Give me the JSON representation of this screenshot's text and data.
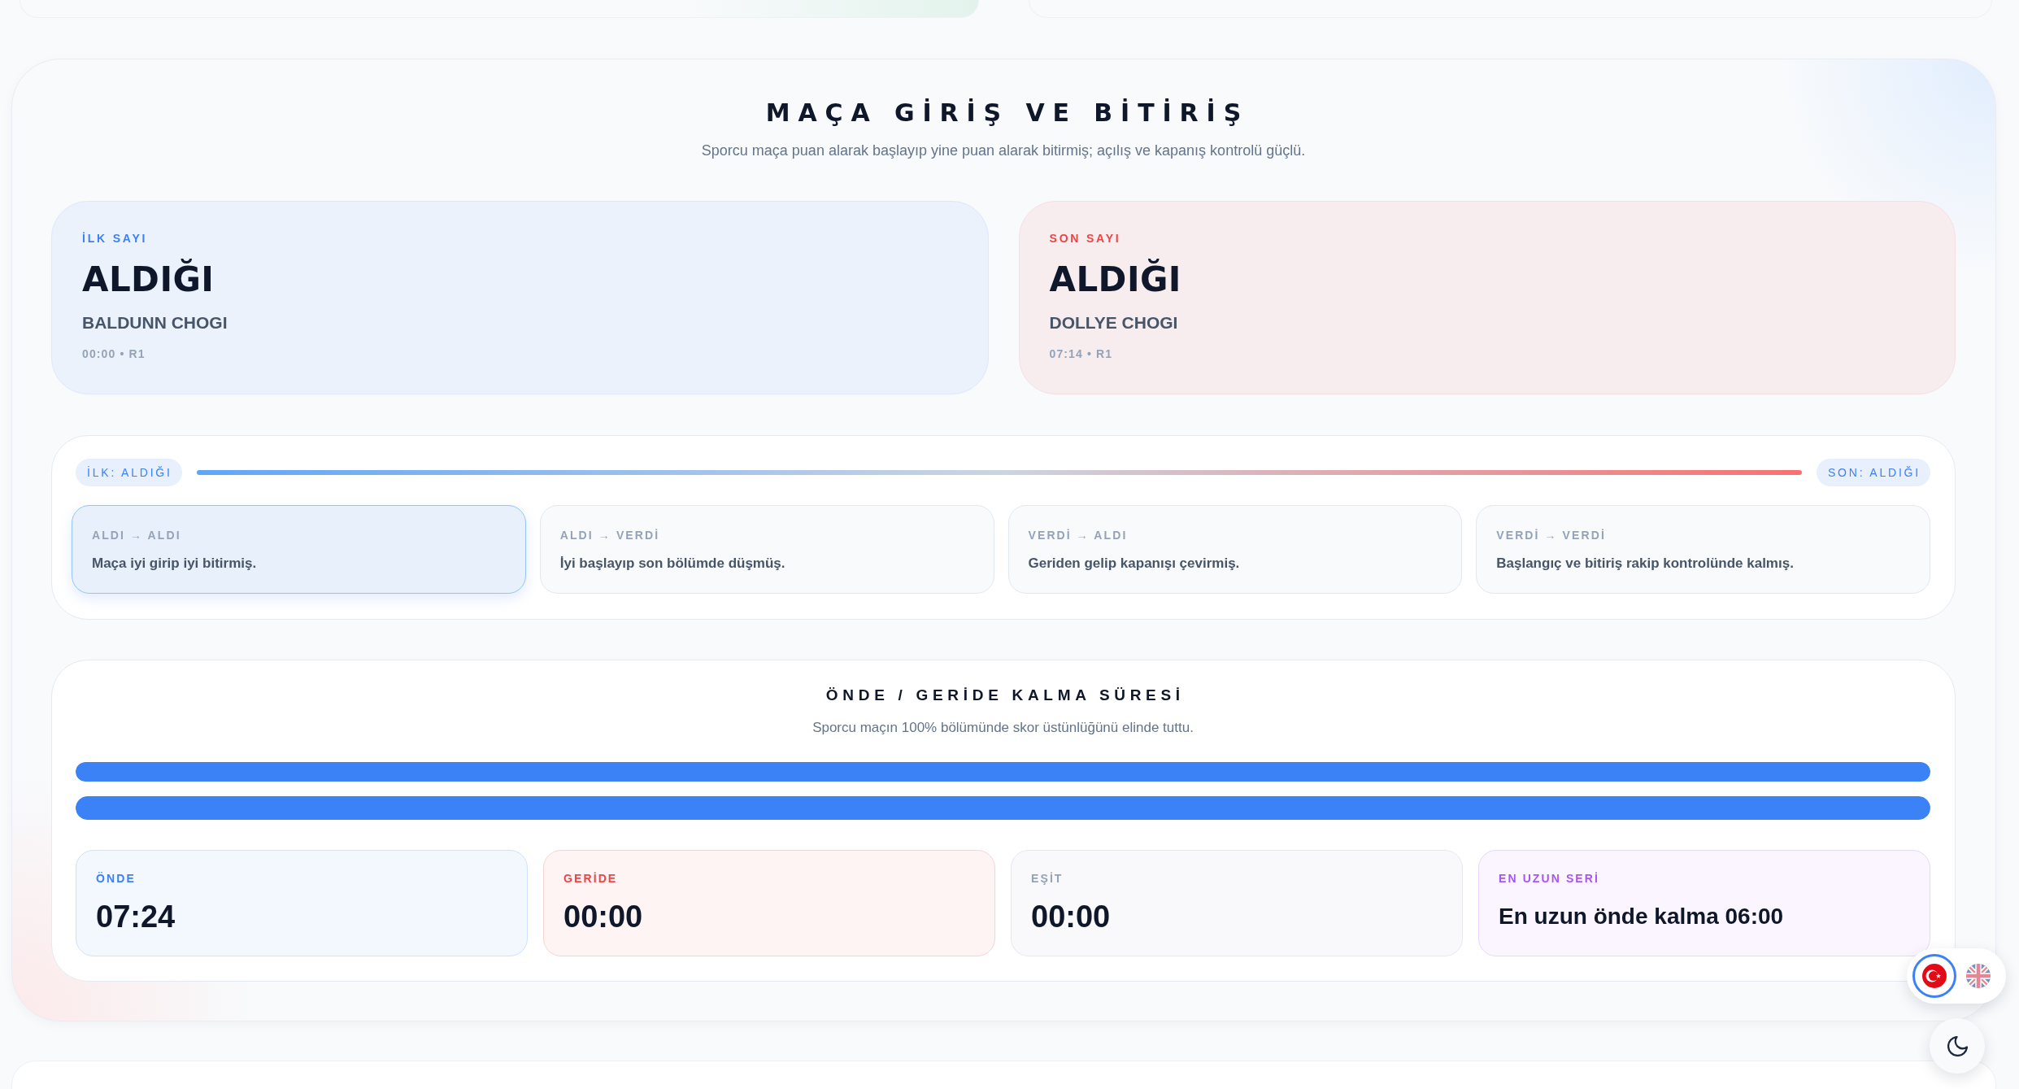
{
  "section": {
    "title": "MAÇA GİRİŞ VE BİTİRİŞ",
    "subtitle": "Sporcu maça puan alarak başlayıp yine puan alarak bitirmiş; açılış ve kapanış kontrolü güçlü.",
    "point_cards": [
      {
        "label": "İLK SAYI",
        "result": "ALDIĞI",
        "player": "BALDUNN CHOGI",
        "meta": "00:00 • R1",
        "color": "#3b82f6"
      },
      {
        "label": "SON SAYI",
        "result": "ALDIĞI",
        "player": "DOLLYE CHOGI",
        "meta": "07:14 • R1",
        "color": "#ef4444"
      }
    ],
    "flow": {
      "start_badge": "İLK: ALDIĞI",
      "end_badge": "SON: ALDIĞI",
      "scenarios": [
        {
          "label": "ALDI → ALDI",
          "text": "Maça iyi girip iyi bitirmiş.",
          "selected": true
        },
        {
          "label": "ALDI → VERDİ",
          "text": "İyi başlayıp son bölümde düşmüş.",
          "selected": false
        },
        {
          "label": "VERDİ → ALDI",
          "text": "Geriden gelip kapanışı çevirmiş.",
          "selected": false
        },
        {
          "label": "VERDİ → VERDİ",
          "text": "Başlangıç ve bitiriş rakip kontrolünde kalmış.",
          "selected": false
        }
      ]
    },
    "lead_time": {
      "title": "ÖNDE / GERİDE KALMA SÜRESİ",
      "subtitle": "Sporcu maçın 100% bölümünde skor üstünlüğünü elinde tuttu.",
      "bars": [
        {
          "level": 1
        },
        {
          "level": 1
        }
      ],
      "stats": [
        {
          "kind": "duration",
          "label": "ÖNDE",
          "value": "07:24",
          "color": "#3b82f6"
        },
        {
          "kind": "duration",
          "label": "GERİDE",
          "value": "00:00",
          "color": "#ef4444"
        },
        {
          "kind": "duration",
          "label": "EŞİT",
          "value": "00:00",
          "color": "#94a3b8"
        },
        {
          "kind": "summary",
          "label": "EN UZUN SERİ",
          "value": "En uzun önde kalma 06:00",
          "color": "#a855f7"
        }
      ]
    }
  },
  "language_switcher": {
    "options": [
      {
        "kind": "tr",
        "selected": true
      },
      {
        "kind": "gb",
        "selected": false
      }
    ]
  }
}
